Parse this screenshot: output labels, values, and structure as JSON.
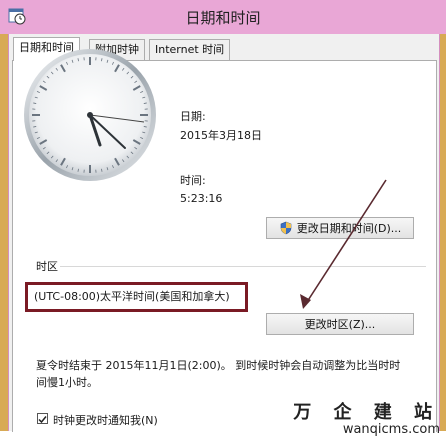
{
  "window": {
    "title": "日期和时间"
  },
  "tabs": [
    {
      "label": "日期和时间",
      "active": true
    },
    {
      "label": "附加时钟",
      "active": false
    },
    {
      "label": "Internet 时间",
      "active": false
    }
  ],
  "date_section": {
    "date_label": "日期:",
    "date_value": "2015年3月18日",
    "time_label": "时间:",
    "time_value": "5:23:16"
  },
  "buttons": {
    "change_datetime": "更改日期和时间(D)...",
    "change_timezone": "更改时区(Z)..."
  },
  "timezone": {
    "section_label": "时区",
    "value": "(UTC-08:00)太平洋时间(美国和加拿大)"
  },
  "dst_notice": {
    "line1": "夏令时结束于 2015年11月1日(2:00)。 到时候时钟会自动调整为比当时时",
    "line2": "间慢1小时。"
  },
  "notify_checkbox": {
    "label": "时钟更改时通知我(N)",
    "checked": true
  },
  "watermark": {
    "chinese": "万 企 建 站",
    "domain": "wanqicms.com"
  },
  "colors": {
    "title_bar": "#e9a7d6",
    "highlight_border": "#7a1a24",
    "arrow": "#5a2a30"
  },
  "icons": {
    "window": "clock-calendar-icon",
    "shield": "uac-shield-icon",
    "arrow": "annotation-arrow"
  }
}
